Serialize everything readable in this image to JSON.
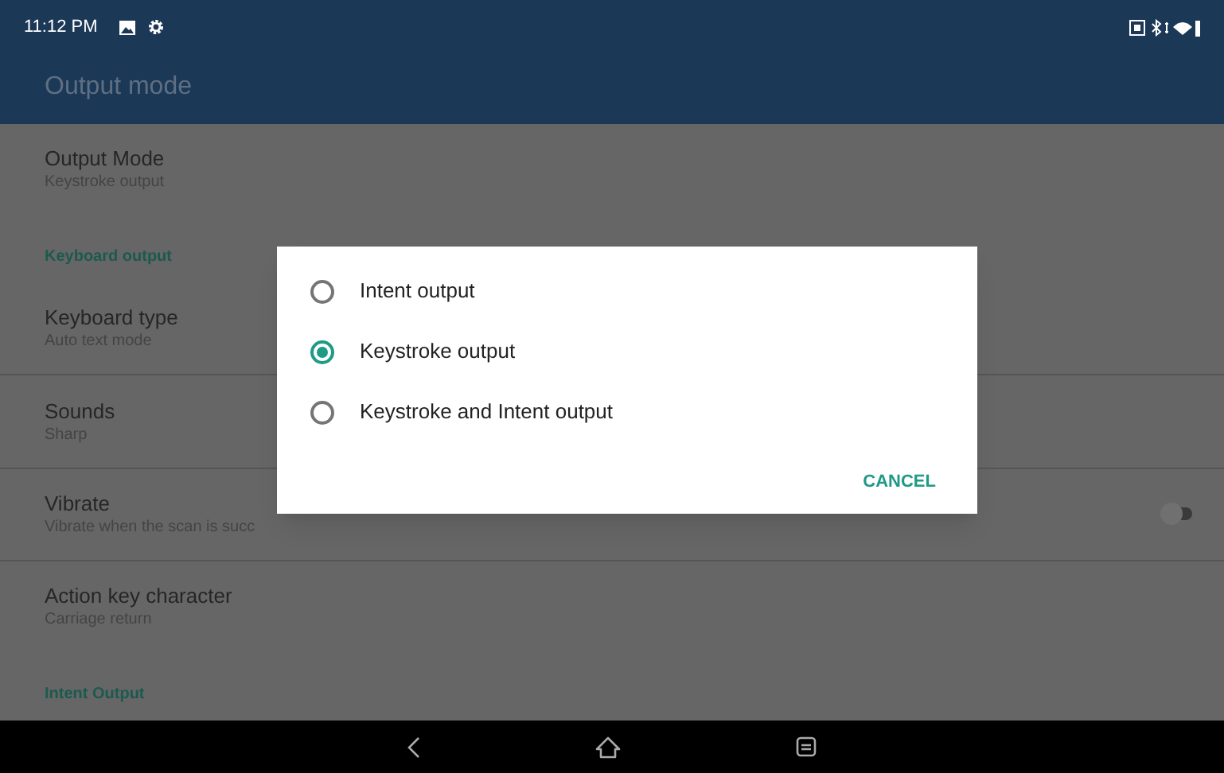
{
  "status_bar": {
    "time": "11:12 PM"
  },
  "app_bar": {
    "title": "Output mode"
  },
  "settings": [
    {
      "kind": "item",
      "title": "Output Mode",
      "subtitle": "Keystroke output",
      "divider": false
    },
    {
      "kind": "header",
      "title": "Keyboard output"
    },
    {
      "kind": "item",
      "title": "Keyboard type",
      "subtitle": "Auto text mode",
      "divider": true
    },
    {
      "kind": "item",
      "title": "Sounds",
      "subtitle": "Sharp",
      "divider": true
    },
    {
      "kind": "switch",
      "title": "Vibrate",
      "subtitle": "Vibrate when the scan is succ",
      "on": false,
      "divider": true
    },
    {
      "kind": "item",
      "title": "Action key character",
      "subtitle": "Carriage return",
      "divider": false
    },
    {
      "kind": "header",
      "title": "Intent Output"
    }
  ],
  "dialog": {
    "options": [
      {
        "label": "Intent output",
        "selected": false
      },
      {
        "label": "Keystroke output",
        "selected": true
      },
      {
        "label": "Keystroke and Intent output",
        "selected": false
      }
    ],
    "cancel": "CANCEL"
  }
}
